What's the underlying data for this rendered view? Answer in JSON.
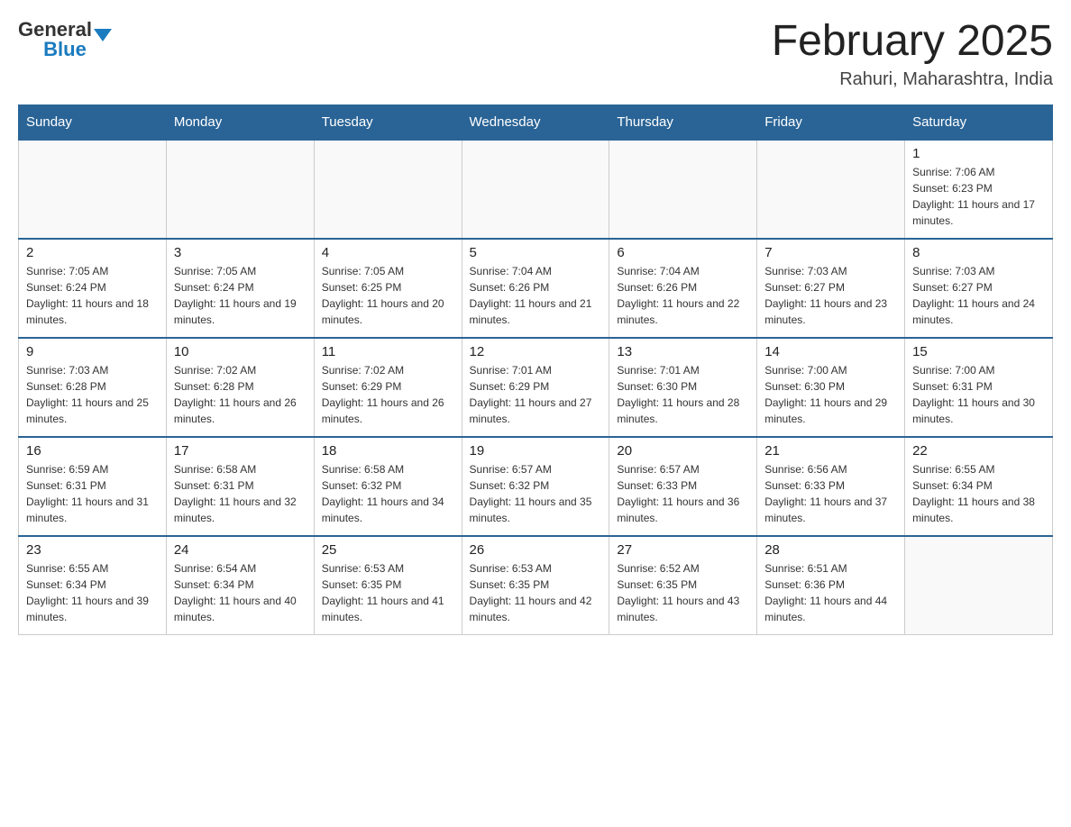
{
  "header": {
    "logo": {
      "general": "General",
      "blue": "Blue"
    },
    "title": "February 2025",
    "location": "Rahuri, Maharashtra, India"
  },
  "weekdays": [
    "Sunday",
    "Monday",
    "Tuesday",
    "Wednesday",
    "Thursday",
    "Friday",
    "Saturday"
  ],
  "weeks": [
    [
      {
        "day": "",
        "info": ""
      },
      {
        "day": "",
        "info": ""
      },
      {
        "day": "",
        "info": ""
      },
      {
        "day": "",
        "info": ""
      },
      {
        "day": "",
        "info": ""
      },
      {
        "day": "",
        "info": ""
      },
      {
        "day": "1",
        "info": "Sunrise: 7:06 AM\nSunset: 6:23 PM\nDaylight: 11 hours and 17 minutes."
      }
    ],
    [
      {
        "day": "2",
        "info": "Sunrise: 7:05 AM\nSunset: 6:24 PM\nDaylight: 11 hours and 18 minutes."
      },
      {
        "day": "3",
        "info": "Sunrise: 7:05 AM\nSunset: 6:24 PM\nDaylight: 11 hours and 19 minutes."
      },
      {
        "day": "4",
        "info": "Sunrise: 7:05 AM\nSunset: 6:25 PM\nDaylight: 11 hours and 20 minutes."
      },
      {
        "day": "5",
        "info": "Sunrise: 7:04 AM\nSunset: 6:26 PM\nDaylight: 11 hours and 21 minutes."
      },
      {
        "day": "6",
        "info": "Sunrise: 7:04 AM\nSunset: 6:26 PM\nDaylight: 11 hours and 22 minutes."
      },
      {
        "day": "7",
        "info": "Sunrise: 7:03 AM\nSunset: 6:27 PM\nDaylight: 11 hours and 23 minutes."
      },
      {
        "day": "8",
        "info": "Sunrise: 7:03 AM\nSunset: 6:27 PM\nDaylight: 11 hours and 24 minutes."
      }
    ],
    [
      {
        "day": "9",
        "info": "Sunrise: 7:03 AM\nSunset: 6:28 PM\nDaylight: 11 hours and 25 minutes."
      },
      {
        "day": "10",
        "info": "Sunrise: 7:02 AM\nSunset: 6:28 PM\nDaylight: 11 hours and 26 minutes."
      },
      {
        "day": "11",
        "info": "Sunrise: 7:02 AM\nSunset: 6:29 PM\nDaylight: 11 hours and 26 minutes."
      },
      {
        "day": "12",
        "info": "Sunrise: 7:01 AM\nSunset: 6:29 PM\nDaylight: 11 hours and 27 minutes."
      },
      {
        "day": "13",
        "info": "Sunrise: 7:01 AM\nSunset: 6:30 PM\nDaylight: 11 hours and 28 minutes."
      },
      {
        "day": "14",
        "info": "Sunrise: 7:00 AM\nSunset: 6:30 PM\nDaylight: 11 hours and 29 minutes."
      },
      {
        "day": "15",
        "info": "Sunrise: 7:00 AM\nSunset: 6:31 PM\nDaylight: 11 hours and 30 minutes."
      }
    ],
    [
      {
        "day": "16",
        "info": "Sunrise: 6:59 AM\nSunset: 6:31 PM\nDaylight: 11 hours and 31 minutes."
      },
      {
        "day": "17",
        "info": "Sunrise: 6:58 AM\nSunset: 6:31 PM\nDaylight: 11 hours and 32 minutes."
      },
      {
        "day": "18",
        "info": "Sunrise: 6:58 AM\nSunset: 6:32 PM\nDaylight: 11 hours and 34 minutes."
      },
      {
        "day": "19",
        "info": "Sunrise: 6:57 AM\nSunset: 6:32 PM\nDaylight: 11 hours and 35 minutes."
      },
      {
        "day": "20",
        "info": "Sunrise: 6:57 AM\nSunset: 6:33 PM\nDaylight: 11 hours and 36 minutes."
      },
      {
        "day": "21",
        "info": "Sunrise: 6:56 AM\nSunset: 6:33 PM\nDaylight: 11 hours and 37 minutes."
      },
      {
        "day": "22",
        "info": "Sunrise: 6:55 AM\nSunset: 6:34 PM\nDaylight: 11 hours and 38 minutes."
      }
    ],
    [
      {
        "day": "23",
        "info": "Sunrise: 6:55 AM\nSunset: 6:34 PM\nDaylight: 11 hours and 39 minutes."
      },
      {
        "day": "24",
        "info": "Sunrise: 6:54 AM\nSunset: 6:34 PM\nDaylight: 11 hours and 40 minutes."
      },
      {
        "day": "25",
        "info": "Sunrise: 6:53 AM\nSunset: 6:35 PM\nDaylight: 11 hours and 41 minutes."
      },
      {
        "day": "26",
        "info": "Sunrise: 6:53 AM\nSunset: 6:35 PM\nDaylight: 11 hours and 42 minutes."
      },
      {
        "day": "27",
        "info": "Sunrise: 6:52 AM\nSunset: 6:35 PM\nDaylight: 11 hours and 43 minutes."
      },
      {
        "day": "28",
        "info": "Sunrise: 6:51 AM\nSunset: 6:36 PM\nDaylight: 11 hours and 44 minutes."
      },
      {
        "day": "",
        "info": ""
      }
    ]
  ]
}
